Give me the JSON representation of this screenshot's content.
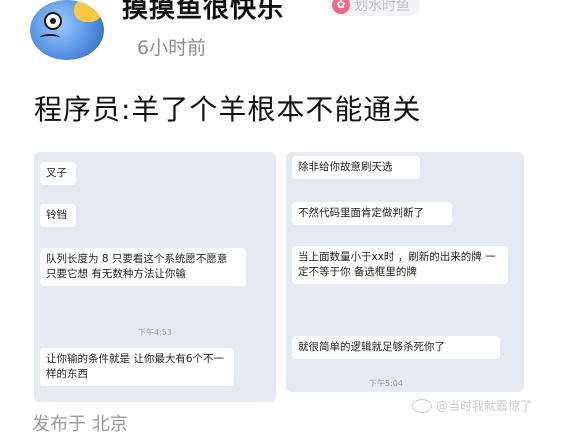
{
  "post": {
    "username": "摸摸鱼很快乐",
    "badge": "划水时鱼",
    "timestamp": "6小时前",
    "title": "程序员:羊了个羊根本不能通关",
    "location": "发布于 北京"
  },
  "chat_left": {
    "messages": [
      "叉子",
      "铃铛",
      "队列长度为 8 只要看这个系统愿不愿意　只要它想 有无数种方法让你输",
      "让你输的条件就是 让你最大有6个不一样的东西"
    ],
    "time": "下午4:53"
  },
  "chat_right": {
    "messages": [
      "除非给你故意刷天选",
      "不然代码里面肯定做判断了",
      "当上面数量小于xx时 ，刷新的出来的牌 一定不等于你 备选框里的牌",
      "就很简单的逻辑就足够杀死你了"
    ],
    "time": "下午5:04"
  },
  "watermark": "@当时我就震惊了"
}
